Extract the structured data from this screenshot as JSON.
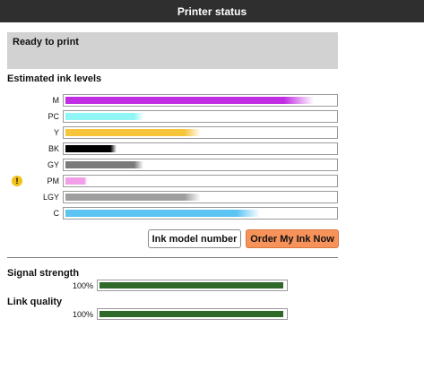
{
  "window": {
    "title": "Printer status"
  },
  "status": {
    "message": "Ready to print"
  },
  "ink": {
    "heading": "Estimated ink levels",
    "cartridges": [
      {
        "label": "M",
        "level": 0.92,
        "color": "#c12de3",
        "warning": false
      },
      {
        "label": "PC",
        "level": 0.29,
        "color": "#8ff5f5",
        "warning": false
      },
      {
        "label": "Y",
        "level": 0.5,
        "color": "#f7c53a",
        "warning": false
      },
      {
        "label": "BK",
        "level": 0.19,
        "color": "#000000",
        "warning": false
      },
      {
        "label": "GY",
        "level": 0.29,
        "color": "#7a7a7a",
        "warning": false
      },
      {
        "label": "PM",
        "level": 0.08,
        "color": "#f39ee8",
        "warning": true
      },
      {
        "label": "LGY",
        "level": 0.5,
        "color": "#9e9e9e",
        "warning": false
      },
      {
        "label": "C",
        "level": 0.72,
        "color": "#5bc4f2",
        "warning": false
      }
    ],
    "warning_icon": "exclamation-icon"
  },
  "buttons": {
    "model_label": "Ink model number",
    "order_label": "Order My Ink Now"
  },
  "signal": {
    "heading": "Signal strength",
    "percent_label": "100%",
    "level": 1.0
  },
  "link": {
    "heading": "Link quality",
    "percent_label": "100%",
    "level": 1.0
  },
  "colors": {
    "meter_green": "#2f6a2a",
    "order_button": "#f7935a",
    "title_bar": "#2f2f2f"
  }
}
